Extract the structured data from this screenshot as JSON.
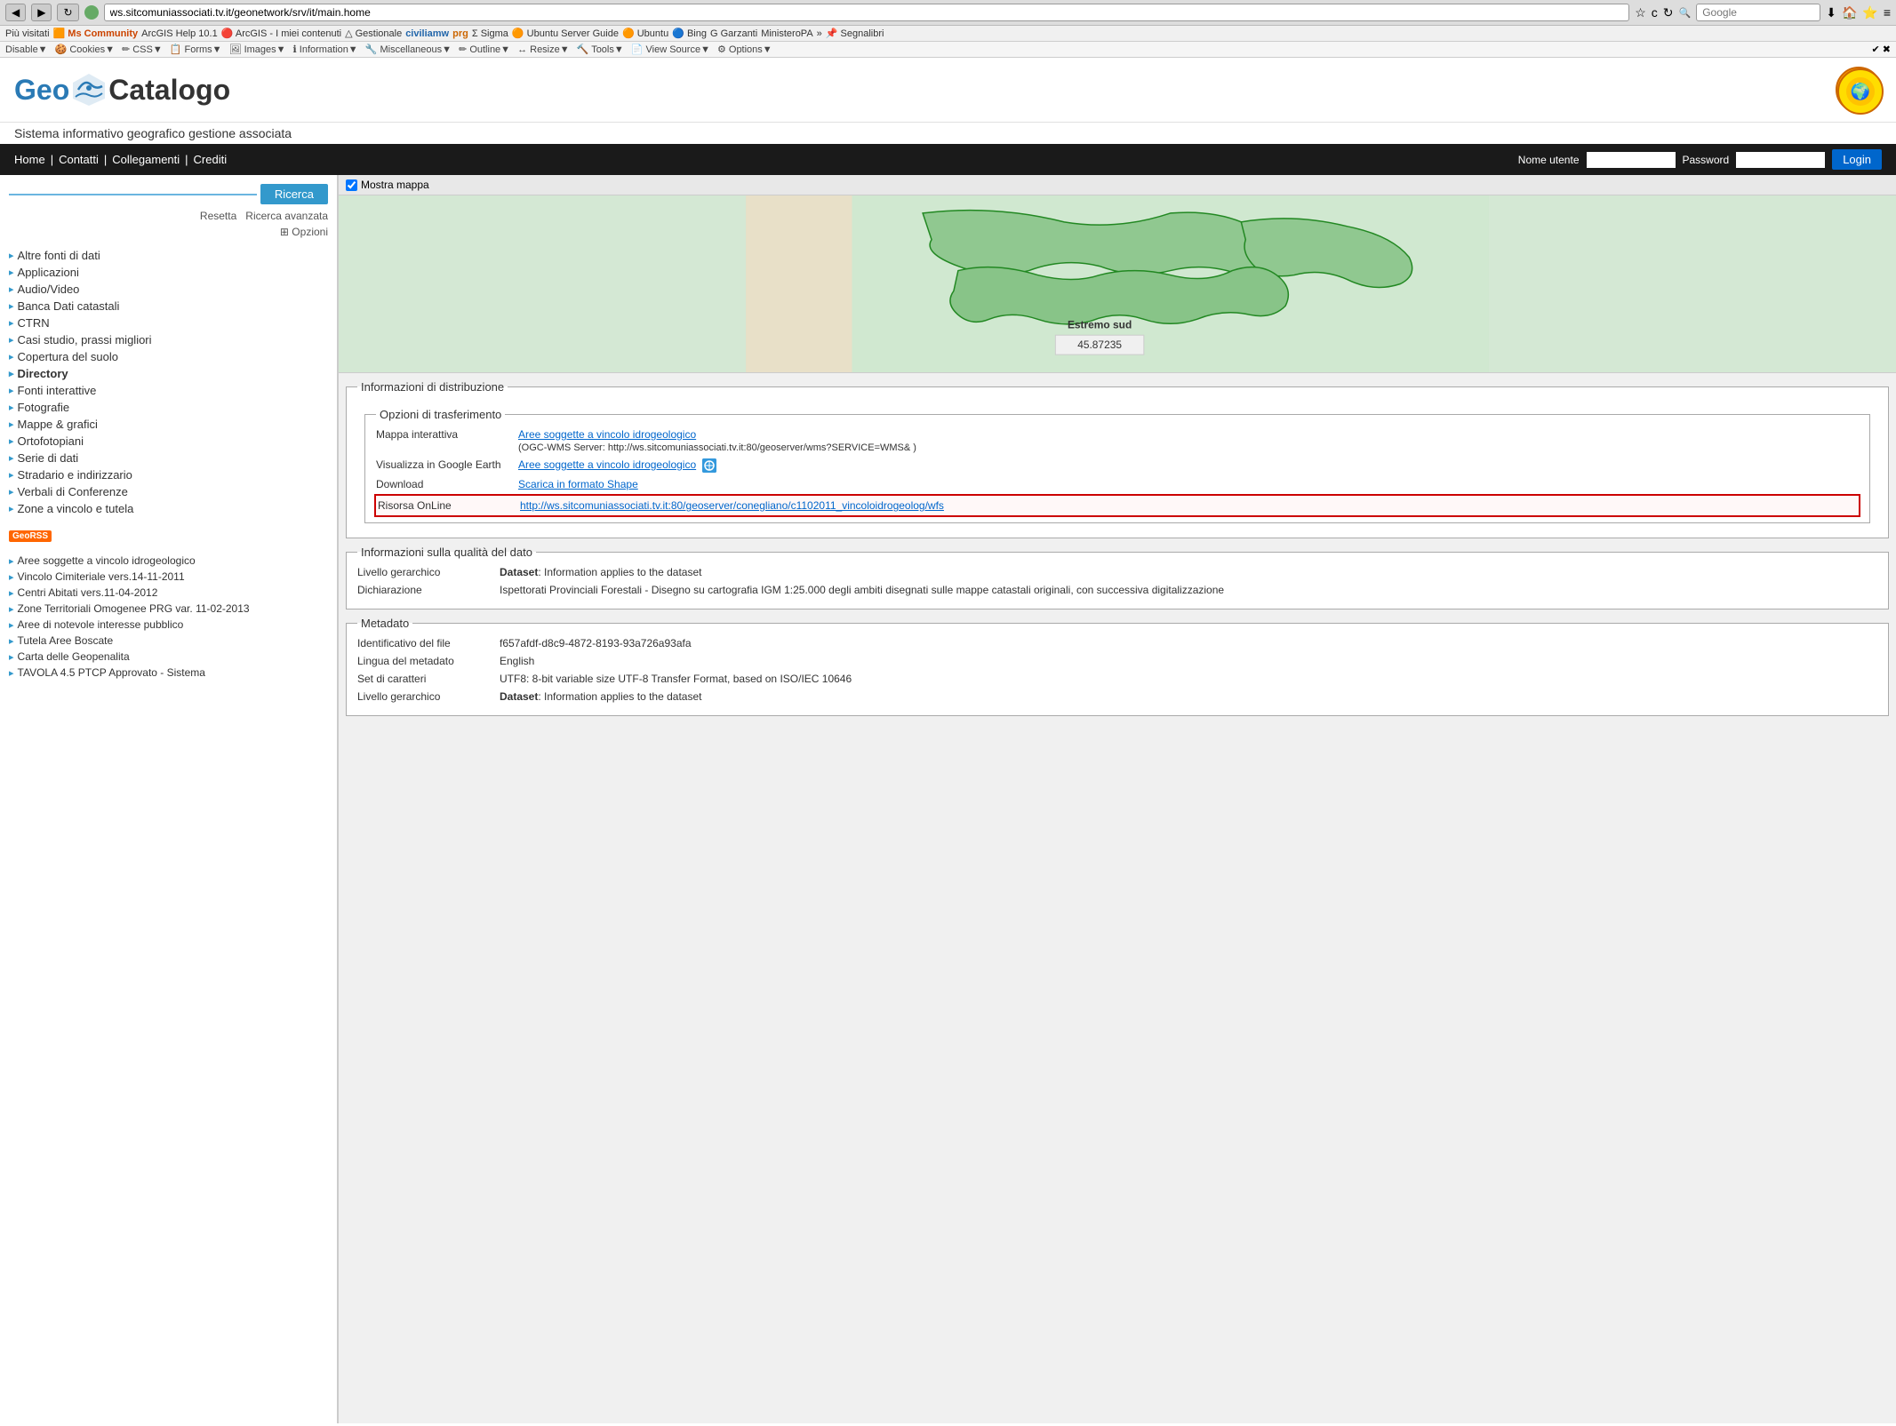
{
  "browser": {
    "address": "ws.sitcomuniassociati.tv.it/geonetwork/srv/it/main.home",
    "search_placeholder": "Google",
    "back_label": "◀",
    "forward_label": "▶",
    "refresh_label": "↻"
  },
  "bookmarks": [
    {
      "label": "Più visitati"
    },
    {
      "label": "Ms Community",
      "colored": true
    },
    {
      "label": "ArcGIS Help 10.1"
    },
    {
      "label": "ArcGIS - I miei contenuti"
    },
    {
      "label": "Gestionale"
    },
    {
      "label": "civiliamw"
    },
    {
      "label": "prg"
    },
    {
      "label": "Sigma"
    },
    {
      "label": "Ubuntu Server Guide"
    },
    {
      "label": "Ubuntu"
    },
    {
      "label": "Bing"
    },
    {
      "label": "Garzanti"
    },
    {
      "label": "MinisteroPA"
    },
    {
      "label": "»"
    },
    {
      "label": "Segnalibri"
    }
  ],
  "devtools": [
    {
      "label": "Disable▼"
    },
    {
      "label": "Cookies▼"
    },
    {
      "label": "CSS▼"
    },
    {
      "label": "Forms▼"
    },
    {
      "label": "Images▼"
    },
    {
      "label": "Information▼"
    },
    {
      "label": "Miscellaneous▼"
    },
    {
      "label": "Outline▼"
    },
    {
      "label": "Resize▼"
    },
    {
      "label": "Tools▼"
    },
    {
      "label": "View Source▼"
    },
    {
      "label": "Options▼"
    }
  ],
  "site": {
    "logo_geo": "Geo",
    "logo_catalogo": "Catalogo",
    "tagline": "Sistema informativo geografico gestione associata",
    "nav_links": [
      "Home",
      "Contatti",
      "Collegamenti",
      "Crediti"
    ],
    "auth": {
      "username_label": "Nome utente",
      "password_label": "Password",
      "login_label": "Login"
    }
  },
  "sidebar": {
    "search_btn": "Ricerca",
    "resetta": "Resetta",
    "ricerca_avanzata": "Ricerca avanzata",
    "opzioni": "⊞ Opzioni",
    "categories": [
      "Altre fonti di dati",
      "Applicazioni",
      "Audio/Video",
      "Banca Dati catastali",
      "CTRN",
      "Casi studio, prassi migliori",
      "Copertura del suolo",
      "Directory",
      "Fonti interattive",
      "Fotografie",
      "Mappe & grafici",
      "Ortofotopiani",
      "Serie di dati",
      "Stradario e indirizzario",
      "Verbali di Conferenze",
      "Zone a vincolo e tutela"
    ],
    "georss_label": "GeoRSS",
    "recent_items": [
      "Aree soggette a vincolo idrogeologico",
      "Vincolo Cimiteriale vers.14-11-2011",
      "Centri Abitati vers.11-04-2012",
      "Zone Territoriali Omogenee PRG var. 11-02-2013",
      "Aree di notevole interesse pubblico",
      "Tutela Aree Boscate",
      "Carta delle Geopenalita",
      "TAVOLA 4.5 PTCP Approvato - Sistema"
    ]
  },
  "content": {
    "map_toggle": "Mostra mappa",
    "map_label": "Estremo sud",
    "map_coord": "45.87235",
    "distribuzione": {
      "section_title": "Informazioni di distribuzione",
      "transfer_title": "Opzioni di trasferimento",
      "rows": [
        {
          "label": "Mappa interattiva",
          "value": "Aree soggette a vincolo idrogeologico",
          "sub": "(OGC-WMS Server: http://ws.sitcomuniassociati.tv.it:80/geoserver/wms?SERVICE=WMS& )",
          "is_link": true
        },
        {
          "label": "Visualizza in Google Earth",
          "value": "Aree soggette a vincolo idrogeologico",
          "has_icon": true,
          "is_link": true
        },
        {
          "label": "Download",
          "value": "Scarica in formato Shape",
          "is_link": true
        },
        {
          "label": "Risorsa OnLine",
          "value": "http://ws.sitcomuniassociati.tv.it:80/geoserver/conegliano/c1102011_vincoloidrogeolog/wfs",
          "is_link": true,
          "highlighted": true
        }
      ]
    },
    "qualita": {
      "section_title": "Informazioni sulla qualità del dato",
      "rows": [
        {
          "label": "Livello gerarchico",
          "value": "Dataset: Information applies to the dataset"
        },
        {
          "label": "Dichiarazione",
          "value": "Ispettorati Provinciali Forestali - Disegno su cartografia IGM 1:25.000 degli ambiti disegnati sulle mappe catastali originali, con successiva digitalizzazione"
        }
      ]
    },
    "metadato": {
      "section_title": "Metadato",
      "rows": [
        {
          "label": "Identificativo del file",
          "value": "f657afdf-d8c9-4872-8193-93a726a93afa"
        },
        {
          "label": "Lingua del metadato",
          "value": "English"
        },
        {
          "label": "Set di caratteri",
          "value": "UTF8: 8-bit variable size UTF-8 Transfer Format, based on ISO/IEC 10646"
        },
        {
          "label": "Livello gerarchico",
          "value": "Dataset: Information applies to the dataset"
        }
      ]
    }
  }
}
